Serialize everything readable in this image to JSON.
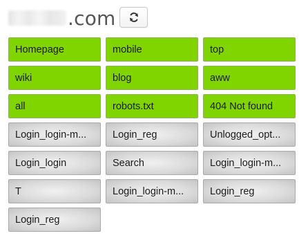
{
  "header": {
    "domain_suffix": ".com",
    "refresh_icon": "refresh-icon"
  },
  "colors": {
    "tile_green": "#80d400",
    "tile_gray": "#d6d6d6",
    "domain_text": "#555555"
  },
  "tiles": [
    {
      "label": "Homepage",
      "style": "green"
    },
    {
      "label": "mobile",
      "style": "green"
    },
    {
      "label": "top",
      "style": "green"
    },
    {
      "label": "wiki",
      "style": "green"
    },
    {
      "label": "blog",
      "style": "green"
    },
    {
      "label": "aww",
      "style": "green"
    },
    {
      "label": "all",
      "style": "green"
    },
    {
      "label": "robots.txt",
      "style": "green"
    },
    {
      "label": "404 Not found",
      "style": "green"
    },
    {
      "label": "Login_login-m...",
      "style": "gray"
    },
    {
      "label": "Login_reg",
      "style": "gray"
    },
    {
      "label": "Unlogged_opt...",
      "style": "gray"
    },
    {
      "label": "Login_login",
      "style": "gray"
    },
    {
      "label": "Search",
      "style": "gray"
    },
    {
      "label": "Login_login-m...",
      "style": "gray"
    },
    {
      "label": "T",
      "style": "gray"
    },
    {
      "label": "Login_login-m...",
      "style": "gray"
    },
    {
      "label": "Login_reg",
      "style": "gray"
    },
    {
      "label": "Login_reg",
      "style": "gray"
    }
  ]
}
